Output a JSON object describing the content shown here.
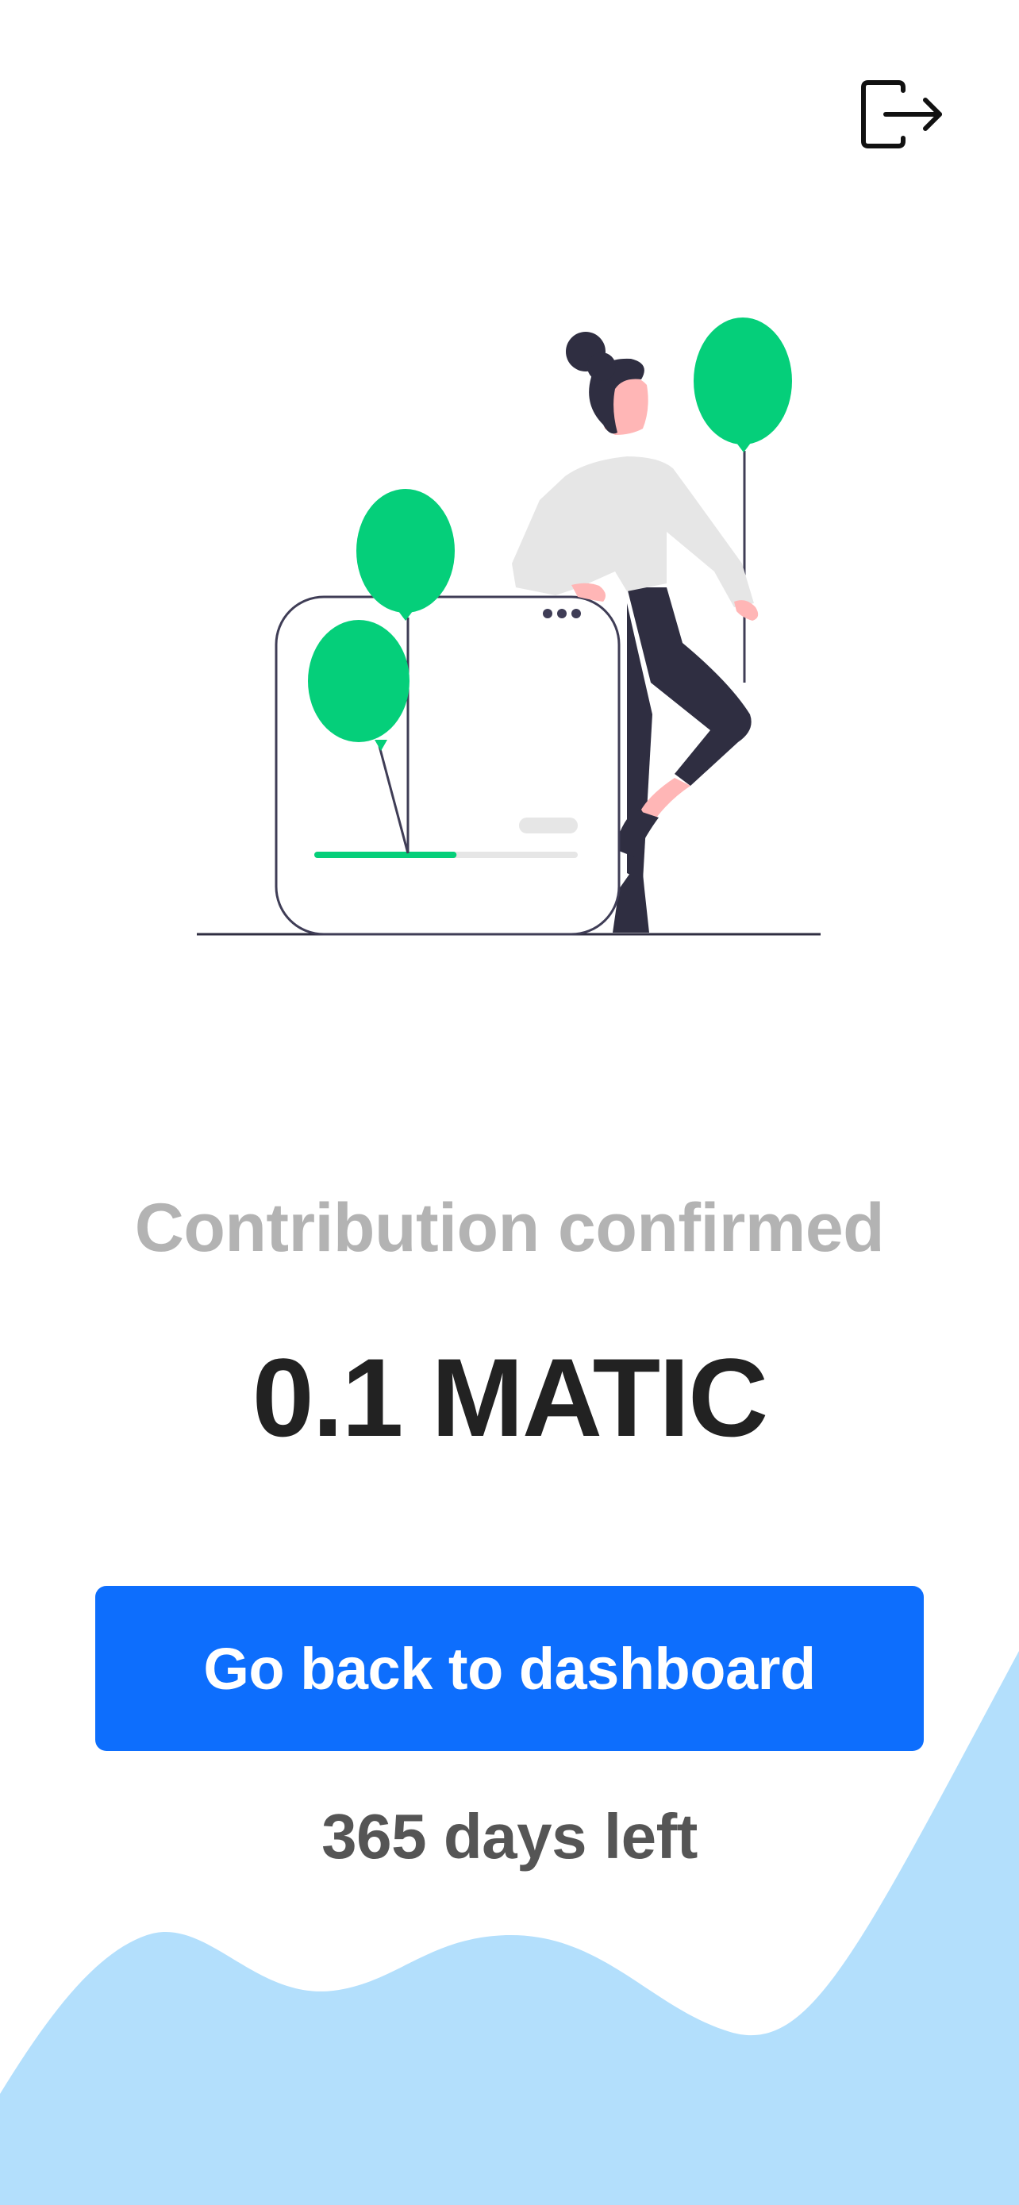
{
  "header": {
    "logout_icon": "logout-arrow-icon"
  },
  "illustration": {
    "balloon_color": "#05cf7a",
    "figure_dark_color": "#2f2e41",
    "skin_color": "#ffb6b6",
    "shirt_color": "#e6e6e6",
    "progress_fraction": 0.54
  },
  "main": {
    "status_title": "Contribution confirmed",
    "amount": "0.1 MATIC",
    "primary_button_label": "Go back to dashboard",
    "days_left": "365 days left"
  },
  "theme": {
    "primary_color": "#0d6efd",
    "wave_color": "#b3dffc"
  }
}
